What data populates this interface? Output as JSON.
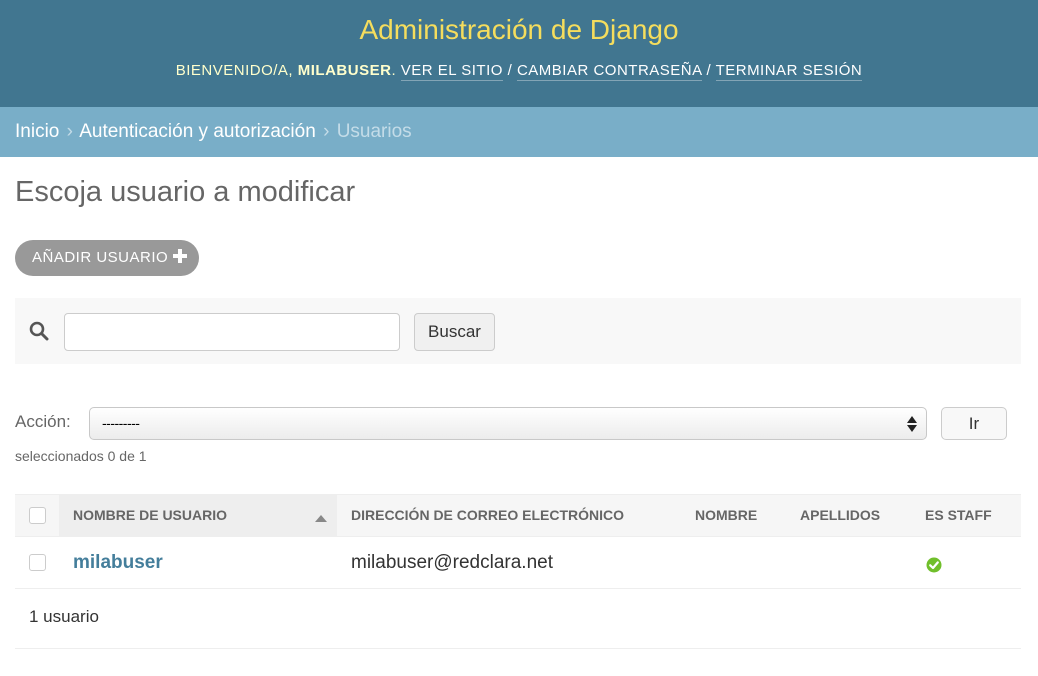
{
  "header": {
    "site_title": "Administración de Django",
    "welcome": "Bienvenido/a,",
    "username": "milabuser",
    "view_site": "Ver el sitio",
    "change_password": "Cambiar contraseña",
    "logout": "Terminar sesión",
    "separator": "/"
  },
  "breadcrumbs": {
    "home": "Inicio",
    "app": "Autenticación y autorización",
    "current": "Usuarios",
    "separator": "›"
  },
  "page": {
    "title": "Escoja usuario a modificar",
    "add_button": "Añadir usuario"
  },
  "search": {
    "value": "",
    "placeholder": "",
    "button": "Buscar"
  },
  "actions": {
    "label": "Acción:",
    "selected_option": "---------",
    "go_button": "Ir",
    "counter": "seleccionados 0 de 1"
  },
  "table": {
    "columns": [
      "Nombre de usuario",
      "Dirección de correo electrónico",
      "Nombre",
      "Apellidos",
      "Es staff"
    ],
    "rows": [
      {
        "username": "milabuser",
        "email": "milabuser@redclara.net",
        "first_name": "",
        "last_name": "",
        "is_staff": true
      }
    ],
    "count_text": "1 usuario"
  },
  "colors": {
    "header_bg": "#417690",
    "title_yellow": "#f5dd5d",
    "breadcrumb_bg": "#79aec8",
    "link": "#447e9b",
    "success": "#70bf2b"
  },
  "icons": {
    "search": "search-icon",
    "add": "plus-icon",
    "boolean_yes": "check-circle-icon",
    "select_arrows": "select-arrows-icon",
    "sort": "sort-ascending-icon"
  }
}
